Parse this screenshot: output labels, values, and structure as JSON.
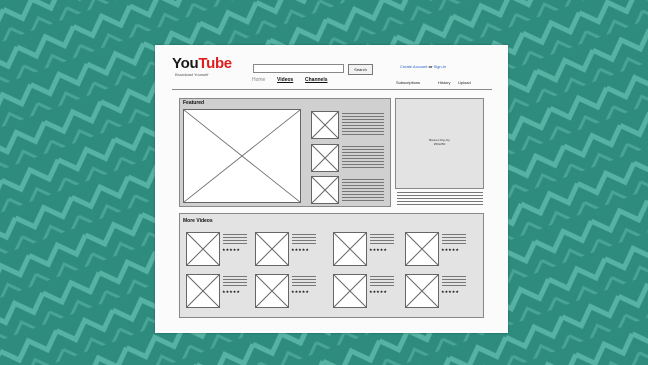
{
  "colors": {
    "background": "#2e8c7e",
    "pattern": "#5bb7a8",
    "card": "#fbfbfb",
    "logo_red": "#e01e1e",
    "link_blue": "#2a62c8"
  },
  "header": {
    "logo_you": "You",
    "logo_tube": "Tube",
    "tagline": "Broadcast Yourself",
    "search_button": "Search",
    "nav": {
      "home": "Home",
      "videos": "Videos",
      "channels": "Channels"
    },
    "account": {
      "create": "Create Account",
      "or": "or",
      "signin": "Sign-In"
    },
    "links": {
      "subscriptions": "Subscriptions",
      "history": "History",
      "upload": "Upload"
    }
  },
  "featured": {
    "title": "Featured"
  },
  "popup": {
    "line1": "Banner Pop-Up",
    "line2": "250x250"
  },
  "more_videos": {
    "title": "More Videos",
    "rating": "★★★★★"
  }
}
